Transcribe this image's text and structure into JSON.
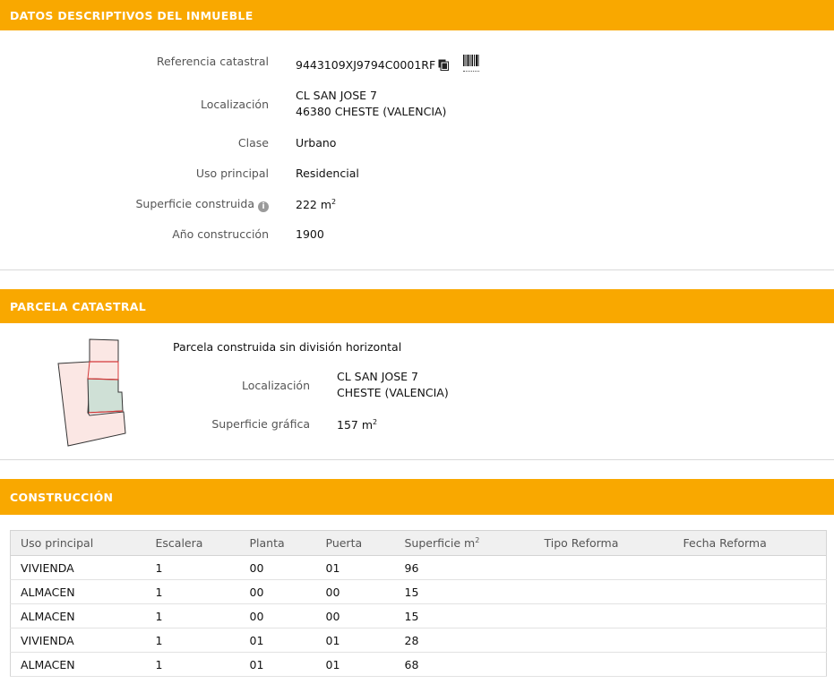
{
  "datos": {
    "header": "DATOS DESCRIPTIVOS DEL INMUEBLE",
    "referencia": {
      "label": "Referencia catastral",
      "value": "9443109XJ9794C0001RF"
    },
    "localizacion": {
      "label": "Localización",
      "line1": "CL SAN JOSE 7",
      "line2": "46380 CHESTE (VALENCIA)"
    },
    "clase": {
      "label": "Clase",
      "value": "Urbano"
    },
    "uso": {
      "label": "Uso principal",
      "value": "Residencial"
    },
    "superficie": {
      "label": "Superficie construida",
      "value": "222 m",
      "unit_sup": "2"
    },
    "anio": {
      "label": "Año construcción",
      "value": "1900"
    },
    "icons": {
      "copy": "copy-icon",
      "barcode": "barcode-icon",
      "info": "info-icon"
    }
  },
  "parcela": {
    "header": "PARCELA CATASTRAL",
    "descripcion": "Parcela construida sin división horizontal",
    "localizacion": {
      "label": "Localización",
      "line1": "CL SAN JOSE 7",
      "line2": "CHESTE (VALENCIA)"
    },
    "superficie": {
      "label": "Superficie gráfica",
      "value": "157 m",
      "unit_sup": "2"
    }
  },
  "construccion": {
    "header": "CONSTRUCCIÓN",
    "columns": [
      "Uso principal",
      "Escalera",
      "Planta",
      "Puerta",
      "Superficie m",
      "Tipo Reforma",
      "Fecha Reforma"
    ],
    "superficie_col_sup": "2",
    "rows": [
      [
        "VIVIENDA",
        "1",
        "00",
        "01",
        "96",
        "",
        ""
      ],
      [
        "ALMACEN",
        "1",
        "00",
        "00",
        "15",
        "",
        ""
      ],
      [
        "ALMACEN",
        "1",
        "00",
        "00",
        "15",
        "",
        ""
      ],
      [
        "VIVIENDA",
        "1",
        "01",
        "01",
        "28",
        "",
        ""
      ],
      [
        "ALMACEN",
        "1",
        "01",
        "01",
        "68",
        "",
        ""
      ]
    ]
  },
  "colors": {
    "header_bg": "#f9a800",
    "parcel_fill": "#fbe7e4",
    "parcel_highlight": "#cfe0d6",
    "parcel_border": "#d43a3a"
  }
}
